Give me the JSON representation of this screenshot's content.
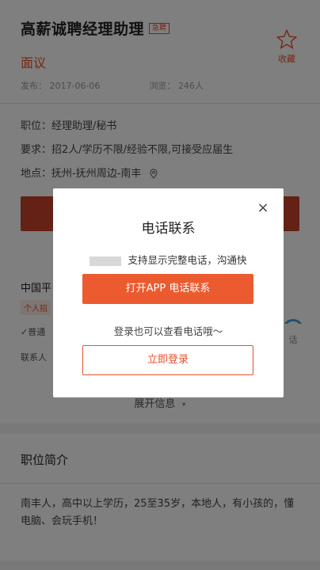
{
  "job": {
    "title": "高薪诚聘经理助理",
    "badge": "急聘",
    "favorite_label": "收藏",
    "salary": "面议",
    "published_label": "发布：",
    "published_date": "2017-06-06",
    "views_label": "浏览：",
    "views_count": "246人",
    "position_line": "职位：经理助理/秘书",
    "requirement_line": "要求：招2人/学历不限/经验不限,可接受应届生",
    "location_line": "地点：抚州-抚州周边-南丰"
  },
  "company": {
    "name": "中国平",
    "tag": "个人招",
    "check": "✓普通",
    "contact": "联系人",
    "call_label": "话",
    "expand_label": "展开信息"
  },
  "intro": {
    "title": "职位简介",
    "text": "南丰人，高中以上学历，25至35岁，本地人，有小孩的，懂电脑、会玩手机！"
  },
  "modal": {
    "title": "电话联系",
    "close": "×",
    "hint": "支持显示完整电话，沟通快",
    "open_app_label": "打开APP 电话联系",
    "login_hint": "登录也可以查看电话哦～",
    "login_label": "立即登录"
  },
  "colors": {
    "accent": "#e8502c",
    "button": "#ec5a2f"
  }
}
